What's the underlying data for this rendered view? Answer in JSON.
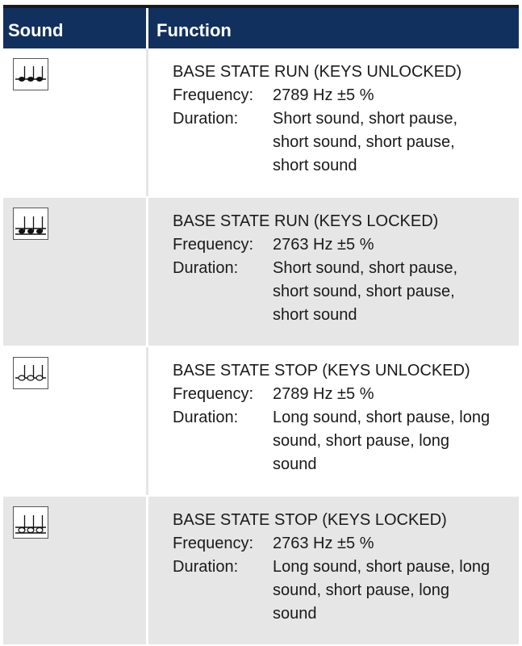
{
  "header": {
    "sound": "Sound",
    "function": "Function"
  },
  "rows": [
    {
      "icon": "run-unlocked-icon",
      "title": "BASE STATE RUN (KEYS UNLOCKED)",
      "freq_label": "Frequency:",
      "freq_value": "2789 Hz ±5 %",
      "dur_label": "Duration:",
      "dur_value": "Short sound, short pause, short sound, short pause, short sound"
    },
    {
      "icon": "run-locked-icon",
      "title": "BASE STATE RUN (KEYS LOCKED)",
      "freq_label": "Frequency:",
      "freq_value": "2763 Hz ±5 %",
      "dur_label": "Duration:",
      "dur_value": "Short sound, short pause, short sound, short pause, short sound"
    },
    {
      "icon": "stop-unlocked-icon",
      "title": "BASE STATE STOP (KEYS UNLOCKED)",
      "freq_label": "Frequency:",
      "freq_value": "2789 Hz ±5 %",
      "dur_label": "Duration:",
      "dur_value": "Long sound, short pause, long sound, short pause, long sound"
    },
    {
      "icon": "stop-locked-icon",
      "title": "BASE STATE STOP (KEYS LOCKED)",
      "freq_label": "Frequency:",
      "freq_value": "2763 Hz ±5 %",
      "dur_label": "Duration:",
      "dur_value": "Long sound, short pause, long sound, short pause, long sound"
    }
  ],
  "colors": {
    "header_bg": "#12305e",
    "row_alt": "#e6e6e6"
  }
}
